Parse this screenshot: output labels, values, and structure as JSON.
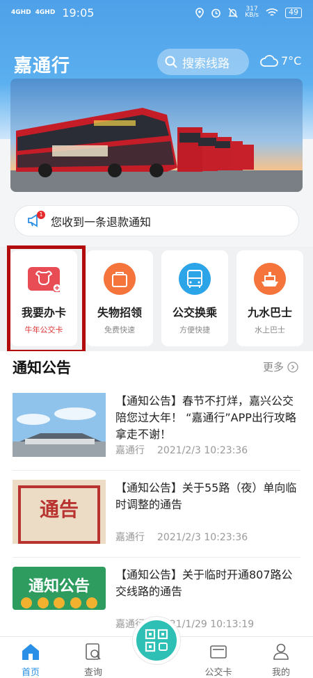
{
  "status_bar": {
    "signal1": "4GHD",
    "signal2": "4GHD",
    "time": "19:05",
    "speed_value": "317",
    "speed_unit": "KB/s",
    "battery": "49"
  },
  "header": {
    "title": "嘉通行",
    "search_label": "搜索线路",
    "temperature": "7°C",
    "weather_icon": "cloud-icon"
  },
  "notice": {
    "text": "您收到一条退款通知",
    "badge": "1"
  },
  "cards": [
    {
      "title": "我要办卡",
      "subtitle": "牛年公交卡",
      "icon": "ox-card-icon",
      "color": "#e84c55"
    },
    {
      "title": "失物招领",
      "subtitle": "免费快速",
      "icon": "bag-icon",
      "color": "#f5743b"
    },
    {
      "title": "公交换乘",
      "subtitle": "方便快捷",
      "icon": "bus-icon",
      "color": "#2ba4e8"
    },
    {
      "title": "九水巴士",
      "subtitle": "水上巴士",
      "icon": "ship-icon",
      "color": "#f5743b"
    }
  ],
  "announcements": {
    "title": "通知公告",
    "more": "更多",
    "items": [
      {
        "text": "【通知公告】春节不打烊，嘉兴公交陪您过大年！ “嘉通行”APP出行攻略拿走不谢！",
        "source": "嘉通行",
        "time": "2021/2/3 10:23:36"
      },
      {
        "text": "【通知公告】关于55路（夜）单向临时调整的通告",
        "source": "嘉通行",
        "time": "2021/2/3 10:23:36",
        "thumb_text": "通告"
      },
      {
        "text": "【通知公告】关于临时开通807路公交线路的通告",
        "source": "嘉通行",
        "time": "2021/1/29 10:13:19",
        "thumb_text": "通知公告"
      }
    ]
  },
  "tabbar": {
    "home": "首页",
    "query": "查询",
    "card": "公交卡",
    "mine": "我的"
  },
  "colors": {
    "primary": "#4ea0e8",
    "active_tab": "#2a8fe6",
    "scan": "#2fc0b5",
    "highlight": "#b30b0b"
  }
}
